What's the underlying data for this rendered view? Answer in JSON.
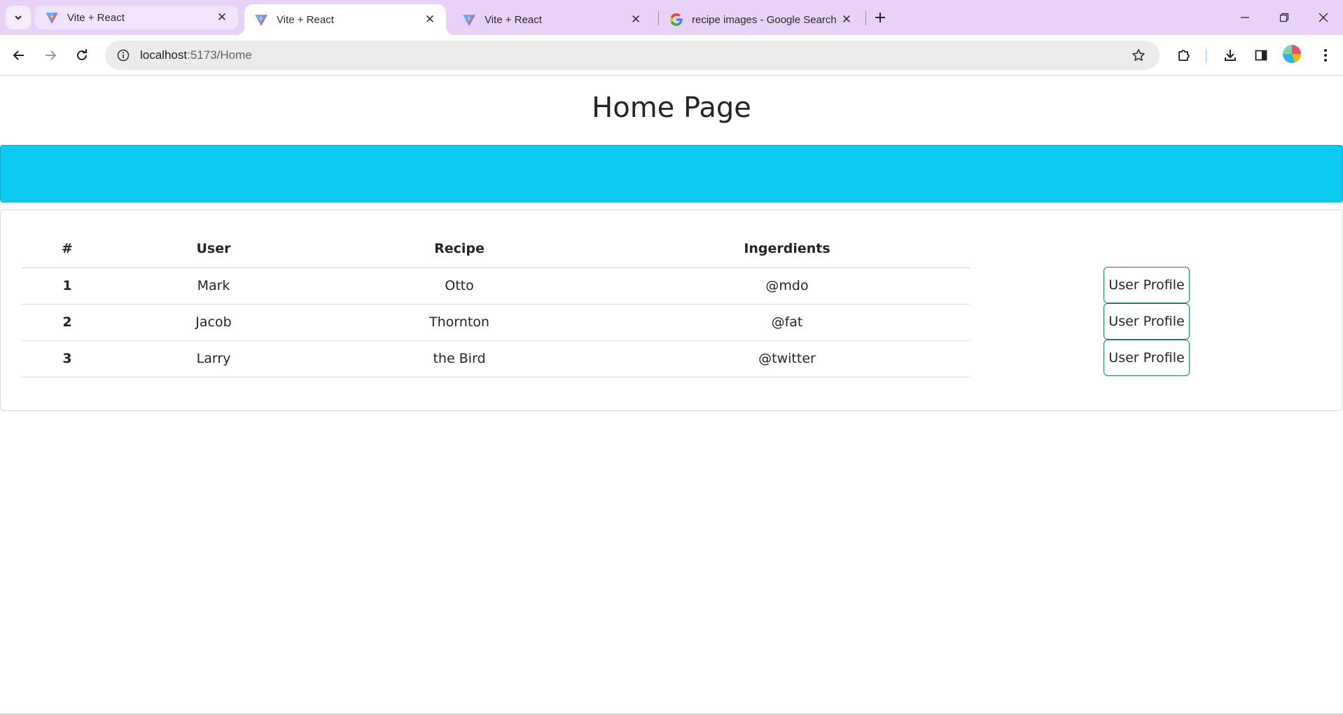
{
  "browser": {
    "tabs": [
      {
        "title": "Vite + React",
        "icon": "vite-icon",
        "state": "inactive"
      },
      {
        "title": "Vite + React",
        "icon": "vite-icon",
        "state": "active"
      },
      {
        "title": "Vite + React",
        "icon": "vite-icon",
        "state": "inactive"
      },
      {
        "title": "recipe images - Google Search",
        "icon": "google-icon",
        "state": "inactive"
      }
    ],
    "url_host": "localhost",
    "url_path": ":5173/Home"
  },
  "page": {
    "title": "Home Page",
    "banner_color": "#0dcaf0",
    "table": {
      "headers": [
        "#",
        "User",
        "Recipe",
        "Ingerdients"
      ],
      "rows": [
        [
          "1",
          "Mark",
          "Otto",
          "@mdo"
        ],
        [
          "2",
          "Jacob",
          "Thornton",
          "@fat"
        ],
        [
          "3",
          "Larry",
          "the Bird",
          "@twitter"
        ]
      ]
    },
    "profile_button_label": "User Profile",
    "button_border_color": "#198754"
  }
}
